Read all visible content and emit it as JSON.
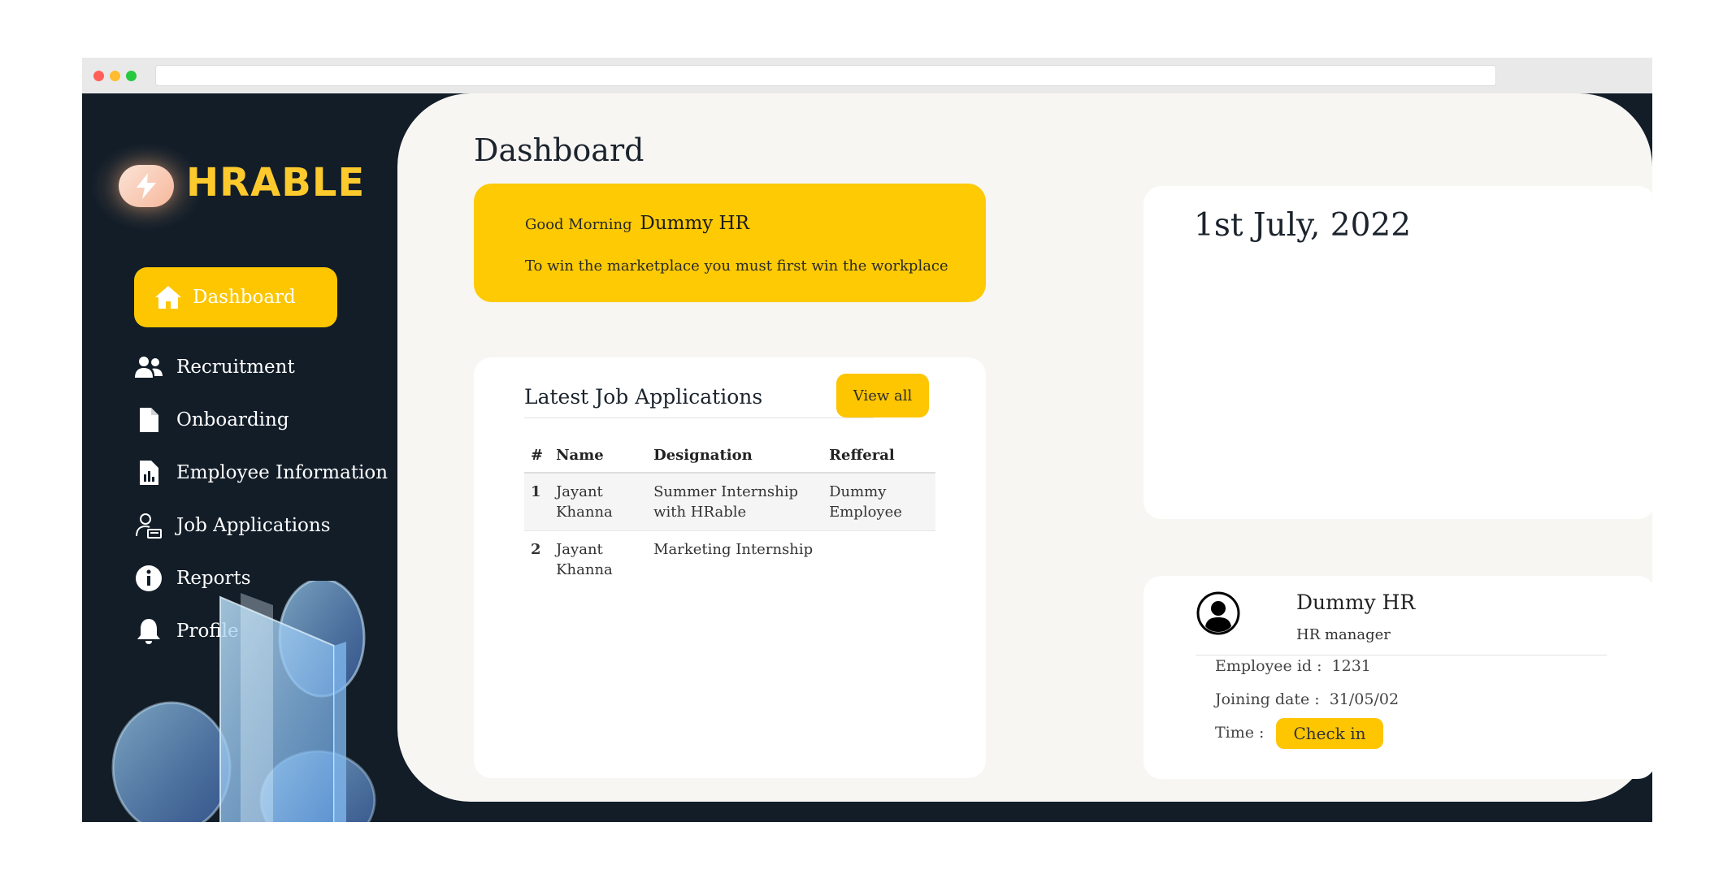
{
  "app": {
    "logo_text": "HRABLE"
  },
  "sidebar": {
    "items": [
      {
        "label": "Dashboard",
        "icon": "home-icon",
        "active": true
      },
      {
        "label": "Recruitment",
        "icon": "users-icon"
      },
      {
        "label": "Onboarding",
        "icon": "file-icon"
      },
      {
        "label": "Employee Information",
        "icon": "file-chart-icon"
      },
      {
        "label": "Job Applications",
        "icon": "user-id-icon"
      },
      {
        "label": "Reports",
        "icon": "info-icon"
      },
      {
        "label": "Profile",
        "icon": "bell-icon"
      }
    ]
  },
  "main": {
    "title": "Dashboard",
    "greeting": {
      "prefix": "Good Morning",
      "name": "Dummy HR",
      "quote": "To win the marketplace you must first win the workplace"
    },
    "applications": {
      "title": "Latest Job Applications",
      "view_all": "View all",
      "columns": [
        "#",
        "Name",
        "Designation",
        "Refferal"
      ],
      "rows": [
        {
          "num": "1",
          "name": "Jayant Khanna",
          "designation": "Summer Internship with HRable",
          "referral": "Dummy Employee"
        },
        {
          "num": "2",
          "name": "Jayant Khanna",
          "designation": "Marketing Internship",
          "referral": ""
        }
      ]
    },
    "date": "1st July, 2022",
    "profile": {
      "name": "Dummy HR",
      "role": "HR manager",
      "employee_id_label": "Employee id :",
      "employee_id": "1231",
      "joining_date_label": "Joining date :",
      "joining_date": "31/05/02",
      "time_label": "Time :",
      "check_in": "Check in"
    }
  },
  "colors": {
    "accent": "#fdc601",
    "sidebar_bg": "#121d28",
    "main_bg": "#f7f6f3",
    "logo": "#fcca2c"
  }
}
